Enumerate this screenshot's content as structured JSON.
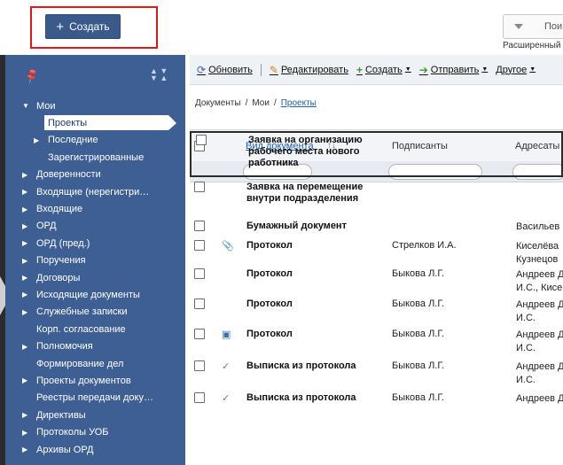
{
  "top": {
    "create_label": "Создать",
    "search_placeholder": "Пои",
    "advanced_search": "Расширенный"
  },
  "sidebar": {
    "items": [
      {
        "label": "Мои",
        "level": 0,
        "arrow": "expanded"
      },
      {
        "label": "Проекты",
        "level": 1,
        "arrow": "none",
        "selected": true
      },
      {
        "label": "Последние",
        "level": 1,
        "arrow": "collapsed"
      },
      {
        "label": "Зарегистрированные",
        "level": 1,
        "arrow": "none"
      },
      {
        "label": "Доверенности",
        "level": 0,
        "arrow": "collapsed"
      },
      {
        "label": "Входящие (нерегистри…",
        "level": 0,
        "arrow": "collapsed"
      },
      {
        "label": "Входящие",
        "level": 0,
        "arrow": "collapsed"
      },
      {
        "label": "ОРД",
        "level": 0,
        "arrow": "collapsed"
      },
      {
        "label": "ОРД (пред.)",
        "level": 0,
        "arrow": "collapsed"
      },
      {
        "label": "Поручения",
        "level": 0,
        "arrow": "collapsed"
      },
      {
        "label": "Договоры",
        "level": 0,
        "arrow": "collapsed"
      },
      {
        "label": "Исходящие документы",
        "level": 0,
        "arrow": "collapsed"
      },
      {
        "label": "Служебные записки",
        "level": 0,
        "arrow": "collapsed"
      },
      {
        "label": "Корп. согласование",
        "level": 0,
        "arrow": "none"
      },
      {
        "label": "Полномочия",
        "level": 0,
        "arrow": "collapsed"
      },
      {
        "label": "Формирование дел",
        "level": 0,
        "arrow": "none"
      },
      {
        "label": "Проекты документов",
        "level": 0,
        "arrow": "collapsed"
      },
      {
        "label": "Реестры передачи доку…",
        "level": 0,
        "arrow": "none"
      },
      {
        "label": "Директивы",
        "level": 0,
        "arrow": "collapsed"
      },
      {
        "label": "Протоколы УОБ",
        "level": 0,
        "arrow": "collapsed"
      },
      {
        "label": "Архивы ОРД",
        "level": 0,
        "arrow": "collapsed"
      }
    ]
  },
  "toolbar": {
    "refresh": "Обновить",
    "edit": "Редактировать",
    "create": "Создать",
    "send": "Отправить",
    "other": "Другое"
  },
  "breadcrumb": {
    "root": "Документы",
    "mine": "Мои",
    "current": "Проекты"
  },
  "grid": {
    "headers": {
      "doctype": "Вид документа",
      "signers": "Подписанты",
      "addressees": "Адресаты"
    },
    "rows": [
      {
        "title": "Заявка на организацию рабочего места нового работника",
        "signer": "",
        "addr": "",
        "icon": ""
      },
      {
        "title": "Заявка на перемещение внутри подразделения",
        "signer": "",
        "addr": "",
        "icon": ""
      },
      {
        "title": "Бумажный документ",
        "signer": "",
        "addr": "Васильев",
        "icon": ""
      },
      {
        "title": "Протокол",
        "signer": "Стрелков И.А.",
        "addr": "Киселёва\nКузнецов",
        "icon": "clip"
      },
      {
        "title": "Протокол",
        "signer": "Быкова Л.Г.",
        "addr": "Андреев Д\nИ.С., Кисе",
        "icon": ""
      },
      {
        "title": "Протокол",
        "signer": "Быкова Л.Г.",
        "addr": "Андреев Д\nИ.С.",
        "icon": ""
      },
      {
        "title": "Протокол",
        "signer": "Быкова Л.Г.",
        "addr": "Андреев Д\nИ.С.",
        "icon": "image"
      },
      {
        "title": "Выписка из протокола",
        "signer": "Быкова Л.Г.",
        "addr": "Андреев Д\nИ.С.",
        "icon": "check"
      },
      {
        "title": "Выписка из протокола",
        "signer": "Быкова Л.Г.",
        "addr": "Андреев Д",
        "icon": "check"
      }
    ]
  }
}
